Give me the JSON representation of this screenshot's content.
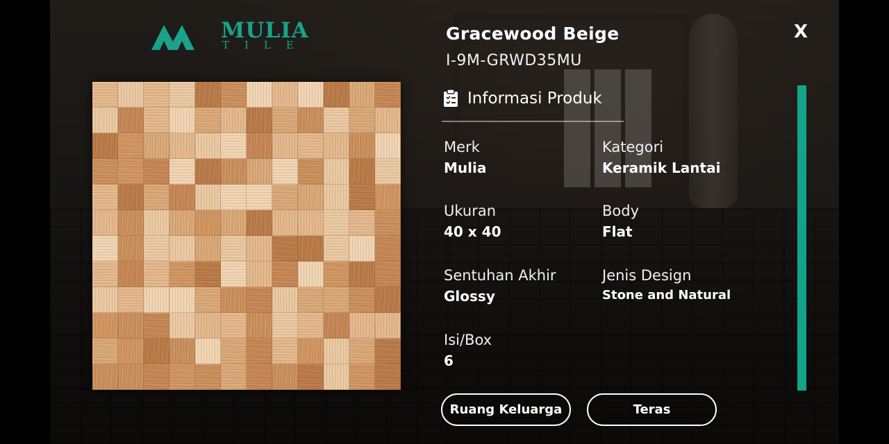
{
  "brand": {
    "name": "MULIA",
    "sub": "TILE",
    "color": "#1aa28a"
  },
  "product": {
    "name": "Gracewood Beige",
    "code": "I-9M-GRWD35MU"
  },
  "close_label": "X",
  "info_section": {
    "label": "Informasi Produk",
    "icon": "clipboard-icon"
  },
  "attributes": {
    "merk": {
      "label": "Merk",
      "value": "Mulia"
    },
    "kategori": {
      "label": "Kategori",
      "value": "Keramik Lantai"
    },
    "ukuran": {
      "label": "Ukuran",
      "value": "40 x 40"
    },
    "body": {
      "label": "Body",
      "value": "Flat"
    },
    "sentuhan": {
      "label": "Sentuhan Akhir",
      "value": "Glossy"
    },
    "jenis": {
      "label": "Jenis Design",
      "value": "Stone and Natural"
    },
    "isi": {
      "label": "Isi/Box",
      "value": "6"
    }
  },
  "rooms": [
    "Ruang Keluarga",
    "Teras"
  ],
  "accent_color": "#12a48a"
}
